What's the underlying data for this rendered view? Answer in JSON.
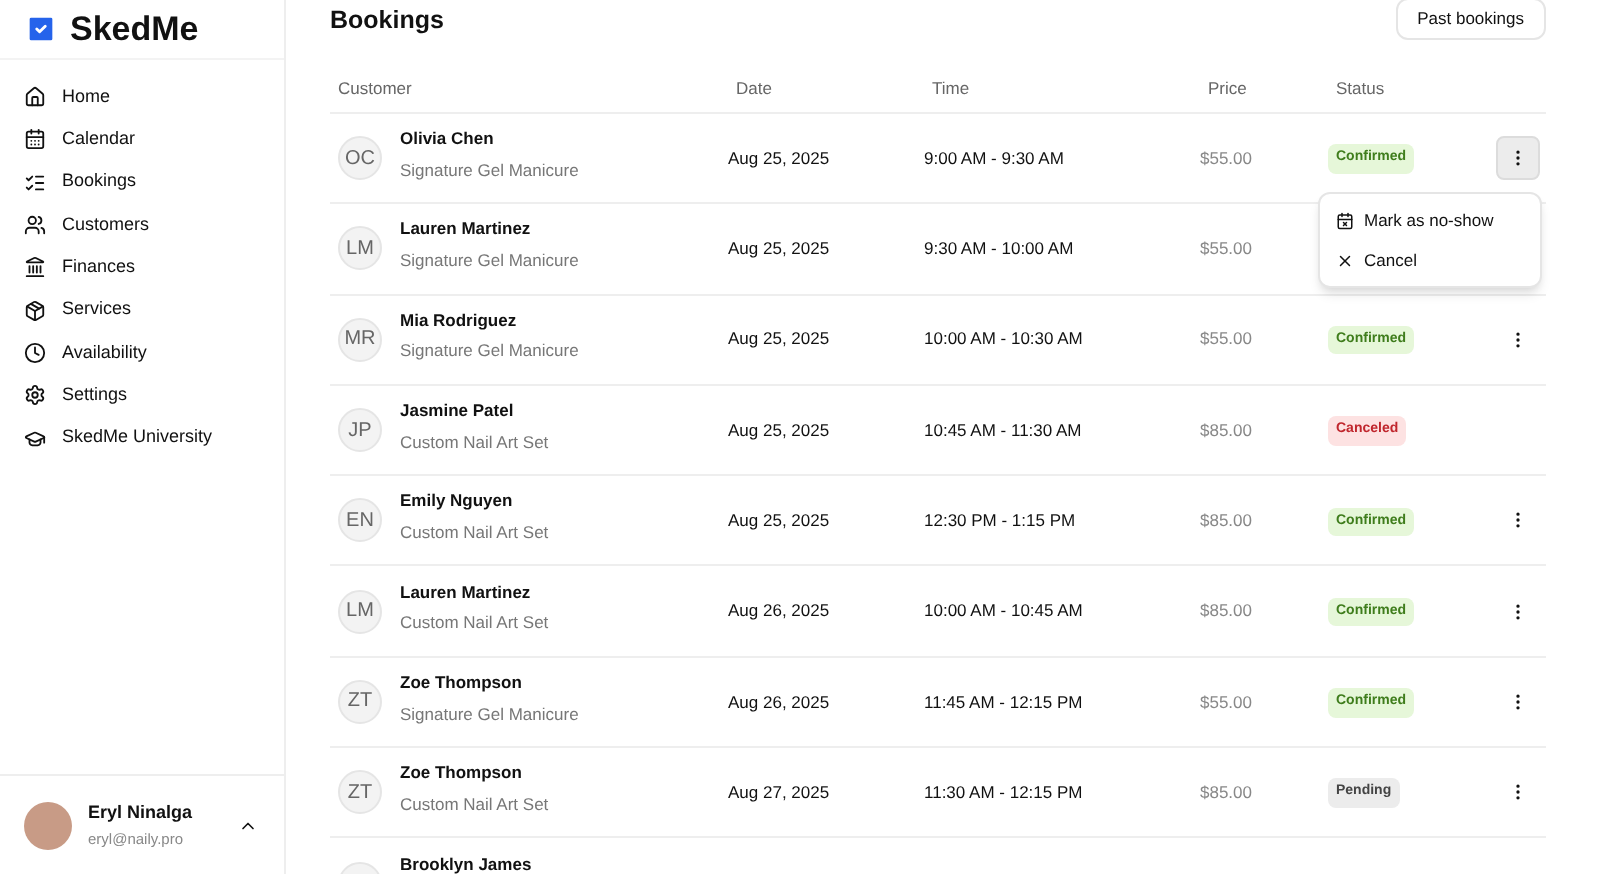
{
  "brand": {
    "name": "SkedMe"
  },
  "sidebar": {
    "items": [
      {
        "label": "Home",
        "selected": false
      },
      {
        "label": "Calendar",
        "selected": false
      },
      {
        "label": "Bookings",
        "selected": false
      },
      {
        "label": "Customers",
        "selected": false
      },
      {
        "label": "Finances",
        "selected": false
      },
      {
        "label": "Services",
        "selected": false
      },
      {
        "label": "Availability",
        "selected": false
      },
      {
        "label": "Settings",
        "selected": false
      },
      {
        "label": "SkedMe University",
        "selected": false
      }
    ]
  },
  "user": {
    "name": "Eryl Ninalga",
    "email": "eryl@naily.pro",
    "expanded": true
  },
  "page": {
    "title": "Bookings",
    "button": "Past bookings"
  },
  "table": {
    "columns": [
      "Customer",
      "Date",
      "Time",
      "Price",
      "Status"
    ],
    "rows": [
      {
        "initials": "OC",
        "name": "Olivia Chen",
        "service": "Signature Gel Manicure",
        "date": "Aug 25, 2025",
        "time": "9:00 AM - 9:30 AM",
        "price": "$55.00",
        "status": {
          "kind": "confirmed",
          "label": "Confirmed"
        },
        "actions": true,
        "menu_open": true
      },
      {
        "initials": "LM",
        "name": "Lauren Martinez",
        "service": "Signature Gel Manicure",
        "date": "Aug 25, 2025",
        "time": "9:30 AM - 10:00 AM",
        "price": "$55.00",
        "actions": false
      },
      {
        "initials": "MR",
        "name": "Mia Rodriguez",
        "service": "Signature Gel Manicure",
        "date": "Aug 25, 2025",
        "time": "10:00 AM - 10:30 AM",
        "price": "$55.00",
        "status": {
          "kind": "confirmed",
          "label": "Confirmed"
        },
        "actions": true,
        "menu_open": false
      },
      {
        "initials": "JP",
        "name": "Jasmine Patel",
        "service": "Custom Nail Art Set",
        "date": "Aug 25, 2025",
        "time": "10:45 AM - 11:30 AM",
        "price": "$85.00",
        "status": {
          "kind": "canceled",
          "label": "Canceled"
        },
        "actions": false
      },
      {
        "initials": "EN",
        "name": "Emily Nguyen",
        "service": "Custom Nail Art Set",
        "date": "Aug 25, 2025",
        "time": "12:30 PM - 1:15 PM",
        "price": "$85.00",
        "status": {
          "kind": "confirmed",
          "label": "Confirmed"
        },
        "actions": true,
        "menu_open": false
      },
      {
        "initials": "LM",
        "name": "Lauren Martinez",
        "service": "Custom Nail Art Set",
        "date": "Aug 26, 2025",
        "time": "10:00 AM - 10:45 AM",
        "price": "$85.00",
        "status": {
          "kind": "confirmed",
          "label": "Confirmed"
        },
        "actions": true,
        "menu_open": false
      },
      {
        "initials": "ZT",
        "name": "Zoe Thompson",
        "service": "Signature Gel Manicure",
        "date": "Aug 26, 2025",
        "time": "11:45 AM - 12:15 PM",
        "price": "$55.00",
        "status": {
          "kind": "confirmed",
          "label": "Confirmed"
        },
        "actions": true,
        "menu_open": false
      },
      {
        "initials": "ZT",
        "name": "Zoe Thompson",
        "service": "Custom Nail Art Set",
        "date": "Aug 27, 2025",
        "time": "11:30 AM - 12:15 PM",
        "price": "$85.00",
        "status": {
          "kind": "pending",
          "label": "Pending"
        },
        "actions": true,
        "menu_open": false
      },
      {
        "name": "Brooklyn James",
        "actions": false
      }
    ]
  },
  "menu": {
    "items": [
      {
        "label": "Mark as no-show"
      },
      {
        "label": "Cancel"
      }
    ]
  }
}
